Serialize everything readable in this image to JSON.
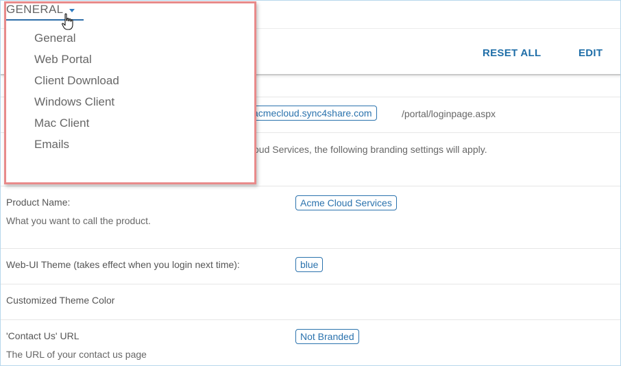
{
  "nav": {
    "selected": "GENERAL"
  },
  "menu": {
    "items": [
      "General",
      "Web Portal",
      "Client Download",
      "Windows Client",
      "Mac Client",
      "Emails"
    ]
  },
  "toolbar": {
    "reset_all": "RESET ALL",
    "edit": "EDIT"
  },
  "login_url": {
    "domain": "acmecloud.sync4share.com",
    "path": "/portal/loginpage.aspx"
  },
  "branding_note": "oud Services, the following branding settings will apply.",
  "product_name": {
    "label": "Product Name:",
    "description": "What you want to call the product.",
    "value": "Acme Cloud Services"
  },
  "theme": {
    "label": "Web-UI Theme (takes effect when you login next time):",
    "value": "blue"
  },
  "custom_color": {
    "label": "Customized Theme Color"
  },
  "contact_url": {
    "label": "'Contact Us' URL",
    "description": "The URL of your contact us page",
    "value": "Not Branded"
  },
  "colors": {
    "accent": "#1f6ea8",
    "menu_border": "#e88a8a"
  },
  "icons": {
    "caret": "caret-down-icon",
    "cursor": "hand-pointer-icon"
  }
}
